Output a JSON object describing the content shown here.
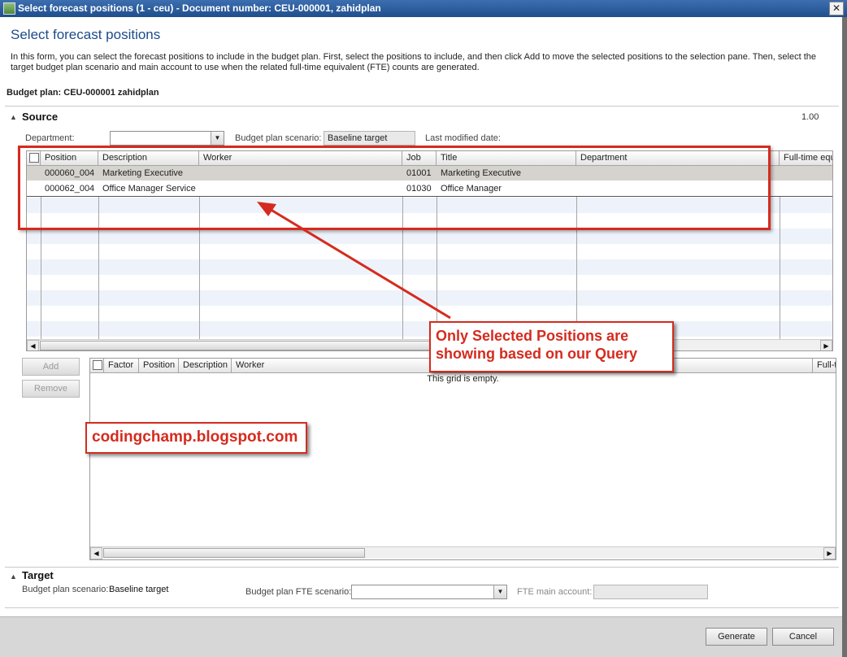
{
  "window": {
    "title": "Select forecast positions (1 - ceu) - Document number: CEU-000001, zahidplan",
    "close_glyph": "✕"
  },
  "header": {
    "title": "Select forecast positions",
    "description": "In this form, you can select the forecast positions to include in the budget plan. First, select the positions to include, and then click Add to move the selected positions to the selection pane. Then, select the target budget plan scenario and main account to use when the related full-time equivalent (FTE) counts  are generated.",
    "budget_plan": "Budget plan: CEU-000001 zahidplan"
  },
  "source": {
    "title": "Source",
    "toggle_glyph": "▲",
    "corner_value": "1.00",
    "department_label": "Department:",
    "department_value": "",
    "scenario_label": "Budget plan scenario:",
    "scenario_value": "Baseline target",
    "modified_label": "Last modified date:",
    "columns": [
      "Position",
      "Description",
      "Worker",
      "Job",
      "Title",
      "Department",
      "Full-time equ"
    ],
    "rows": [
      [
        "000060_004",
        "Marketing Executive",
        "",
        "01001",
        "Marketing Executive",
        "",
        ""
      ],
      [
        "000062_004",
        "Office Manager Service",
        "",
        "01030",
        "Office Manager",
        "",
        ""
      ]
    ]
  },
  "actions": {
    "add_label": "Add",
    "remove_label": "Remove"
  },
  "selection": {
    "columns": [
      "Factor",
      "Position",
      "Description",
      "Worker",
      "Full-t"
    ],
    "empty_text": "This grid is empty."
  },
  "target": {
    "title": "Target",
    "toggle_glyph": "▲",
    "scenario_label": "Budget plan scenario:",
    "scenario_value": "Baseline target",
    "fte_scenario_label": "Budget plan FTE scenario:",
    "fte_scenario_value": "",
    "fte_account_label": "FTE main account:",
    "fte_account_value": ""
  },
  "footer": {
    "generate_label": "Generate",
    "cancel_label": "Cancel"
  },
  "annotations": {
    "callout_text_line1": "Only Selected Positions are",
    "callout_text_line2": "showing based on our Query",
    "blog_text": "codingchamp.blogspot.com",
    "accent_color": "#d52b1e"
  },
  "glyphs": {
    "dropdown": "▼",
    "scroll_left": "◀",
    "scroll_right": "▶"
  }
}
